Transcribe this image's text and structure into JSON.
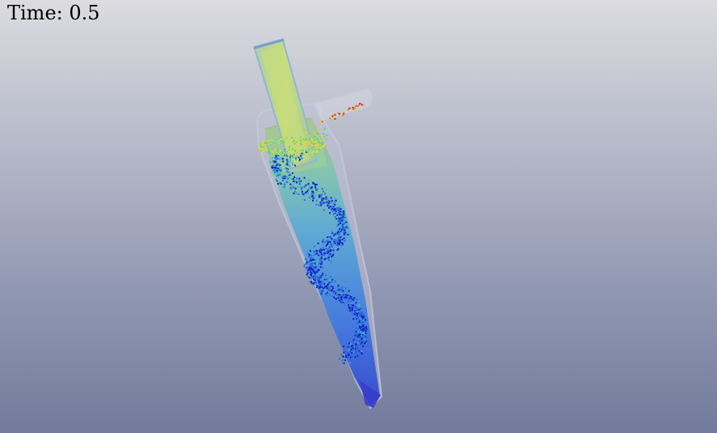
{
  "overlay": {
    "time_label": "Time:",
    "time_value": "0.5"
  },
  "scene": {
    "object": "cyclone-separator",
    "colormap": [
      "#1020c8",
      "#2f6de0",
      "#3fb0c8",
      "#62d09a",
      "#b8e05a",
      "#e8d040",
      "#e07a30",
      "#d02020"
    ],
    "background_top": "#dcdce0",
    "background_bottom": "#737b9c"
  }
}
